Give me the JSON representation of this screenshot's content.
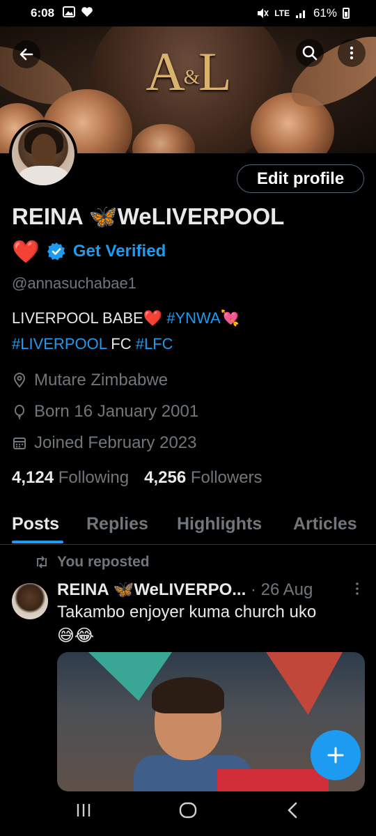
{
  "status_bar": {
    "time": "6:08",
    "network": "LTE",
    "battery": "61%"
  },
  "profile": {
    "monogram": "A",
    "monogram_amp": "&",
    "monogram2": "L",
    "display_name": "REINA 🦋WeLIVERPOOL",
    "name_emoji": "❤️",
    "get_verified": "Get Verified",
    "handle": "@annasuchabae1",
    "bio_line1_text": "LIVERPOOL BABE❤️ ",
    "bio_line1_tag": "#YNWA",
    "bio_line1_emoji": "💘",
    "bio_line2_tag1": "#LIVERPOOL",
    "bio_line2_text": " FC ",
    "bio_line2_tag2": "#LFC",
    "location": "Mutare Zimbabwe",
    "birthday": "Born 16 January 2001",
    "joined": "Joined February 2023",
    "following_count": "4,124",
    "following_label": "Following",
    "followers_count": "4,256",
    "followers_label": "Followers",
    "edit_profile": "Edit profile"
  },
  "tabs": [
    {
      "label": "Posts",
      "active": true
    },
    {
      "label": "Replies",
      "active": false
    },
    {
      "label": "Highlights",
      "active": false
    },
    {
      "label": "Articles",
      "active": false
    }
  ],
  "post": {
    "repost_label": "You reposted",
    "author": "REINA 🦋WeLIVERPO...",
    "separator": " · ",
    "date": "26 Aug",
    "text": "Takambo enjoyer kuma church uko",
    "emojis": "😅😂"
  },
  "colors": {
    "accent": "#1d9bf0",
    "muted": "#71767b",
    "text": "#e7e9ea",
    "background": "#000000"
  },
  "icons": {
    "back": "back-arrow-icon",
    "search": "search-icon",
    "more": "more-vertical-icon",
    "location": "location-pin-icon",
    "birthday": "balloon-icon",
    "joined": "calendar-icon",
    "repost": "repost-icon",
    "compose": "plus-icon"
  }
}
